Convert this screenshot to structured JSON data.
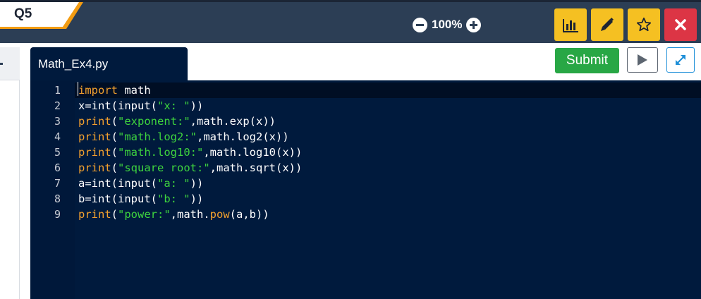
{
  "question": {
    "label": "Q5"
  },
  "zoom": {
    "value": "100%"
  },
  "toolbar": {
    "stats_icon": "bar-chart-icon",
    "edit_icon": "pencil-icon",
    "star_icon": "star-icon",
    "close_icon": "close-icon"
  },
  "editor": {
    "filename": "Math_Ex4.py",
    "lines": [
      {
        "num": "1",
        "tokens": [
          [
            "kw",
            "import"
          ],
          [
            "def",
            " math"
          ]
        ]
      },
      {
        "num": "2",
        "tokens": [
          [
            "def",
            "x=int(input("
          ],
          [
            "str",
            "\"x: \""
          ],
          [
            "def",
            "))"
          ]
        ]
      },
      {
        "num": "3",
        "tokens": [
          [
            "kw",
            "print"
          ],
          [
            "def",
            "("
          ],
          [
            "str",
            "\"exponent:\""
          ],
          [
            "def",
            ",math.exp(x))"
          ]
        ]
      },
      {
        "num": "4",
        "tokens": [
          [
            "kw",
            "print"
          ],
          [
            "def",
            "("
          ],
          [
            "str",
            "\"math.log2:\""
          ],
          [
            "def",
            ",math.log2(x))"
          ]
        ]
      },
      {
        "num": "5",
        "tokens": [
          [
            "kw",
            "print"
          ],
          [
            "def",
            "("
          ],
          [
            "str",
            "\"math.log10:\""
          ],
          [
            "def",
            ",math.log10(x))"
          ]
        ]
      },
      {
        "num": "6",
        "tokens": [
          [
            "kw",
            "print"
          ],
          [
            "def",
            "("
          ],
          [
            "str",
            "\"square root:\""
          ],
          [
            "def",
            ",math.sqrt(x))"
          ]
        ]
      },
      {
        "num": "7",
        "tokens": [
          [
            "def",
            "a=int(input("
          ],
          [
            "str",
            "\"a: \""
          ],
          [
            "def",
            "))"
          ]
        ]
      },
      {
        "num": "8",
        "tokens": [
          [
            "def",
            "b=int(input("
          ],
          [
            "str",
            "\"b: \""
          ],
          [
            "def",
            "))"
          ]
        ]
      },
      {
        "num": "9",
        "tokens": [
          [
            "kw",
            "print"
          ],
          [
            "def",
            "("
          ],
          [
            "str",
            "\"power:\""
          ],
          [
            "def",
            ",math."
          ],
          [
            "kw",
            "pow"
          ],
          [
            "def",
            "(a,b))"
          ]
        ]
      }
    ]
  },
  "actions": {
    "submit_label": "Submit",
    "run_icon": "play-icon",
    "fullscreen_icon": "expand-icon"
  },
  "colors": {
    "topbar": "#2c3e55",
    "editor_bg": "#001a3d",
    "keyword": "#f2a12e",
    "string": "#3ed43e",
    "submit": "#28a745",
    "toolbar_yellow": "#f5c022",
    "close_red": "#dc3545"
  }
}
